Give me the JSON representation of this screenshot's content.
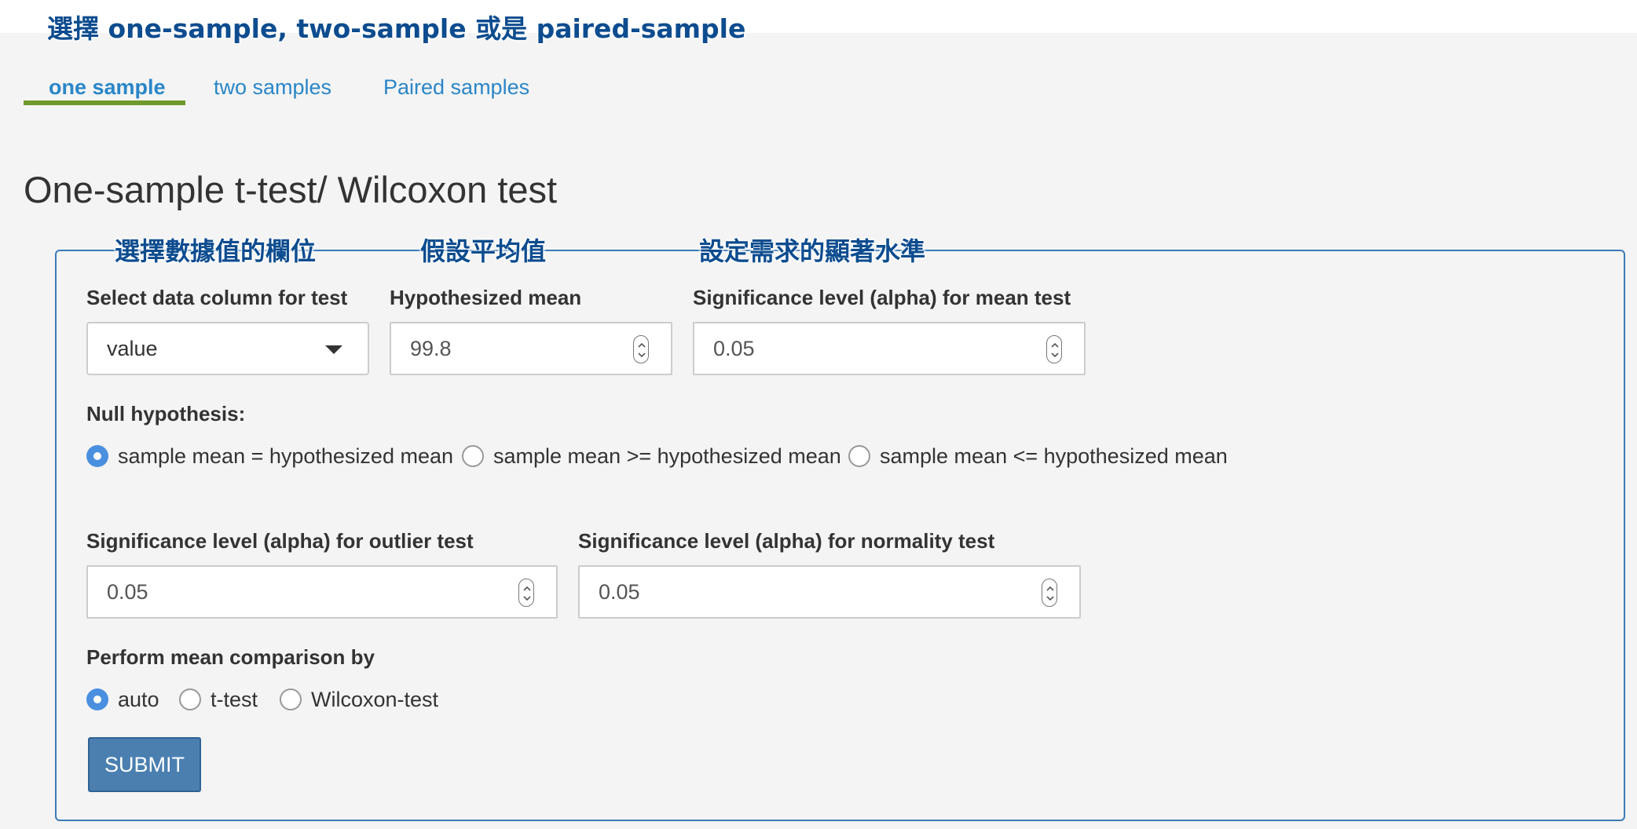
{
  "annotations": {
    "top": "選擇 one-sample, two-sample 或是 paired-sample",
    "column": "選擇數據值的欄位",
    "mean": "假設平均值",
    "alpha": "設定需求的顯著水準"
  },
  "tabs": [
    {
      "label": "one sample",
      "active": true
    },
    {
      "label": "two samples",
      "active": false
    },
    {
      "label": "Paired samples",
      "active": false
    }
  ],
  "page_title": "One-sample t-test/ Wilcoxon test",
  "form": {
    "column_label": "Select data column for test",
    "column_value": "value",
    "mean_label": "Hypothesized mean",
    "mean_value": "99.8",
    "alpha_mean_label": "Significance level (alpha) for mean test",
    "alpha_mean_value": "0.05",
    "null_label": "Null hypothesis:",
    "null_options": [
      {
        "label": "sample mean = hypothesized mean",
        "checked": true
      },
      {
        "label": "sample mean >= hypothesized mean",
        "checked": false
      },
      {
        "label": "sample mean <= hypothesized mean",
        "checked": false
      }
    ],
    "alpha_outlier_label": "Significance level (alpha) for outlier test",
    "alpha_outlier_value": "0.05",
    "alpha_normality_label": "Significance level (alpha) for normality test",
    "alpha_normality_value": "0.05",
    "compare_label": "Perform mean comparison by",
    "compare_options": [
      {
        "label": "auto",
        "checked": true
      },
      {
        "label": "t-test",
        "checked": false
      },
      {
        "label": "Wilcoxon-test",
        "checked": false
      }
    ],
    "submit_label": "SUBMIT"
  },
  "colors": {
    "accent": "#2a86c8",
    "tab_underline": "#6f9a2b",
    "panel_border": "#3a7ab8",
    "radio_checked": "#4a8fe0",
    "button": "#4a7fb0",
    "annotation": "#0d4c8f"
  }
}
